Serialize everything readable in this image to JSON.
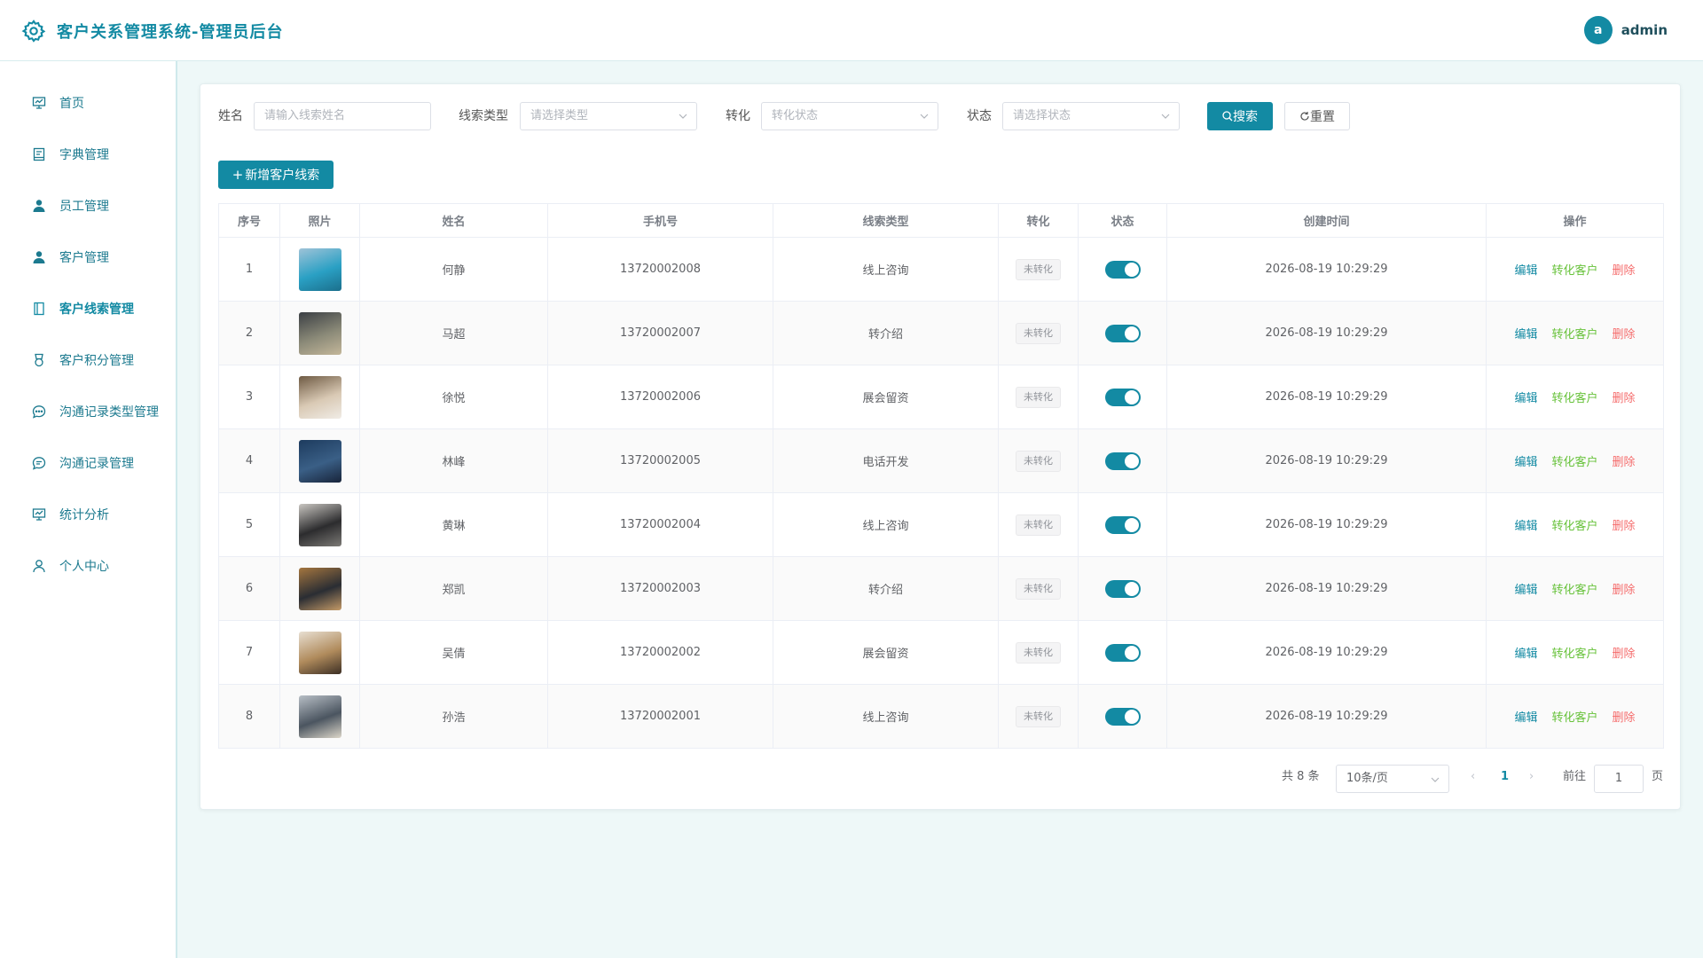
{
  "header": {
    "title": "客户关系管理系统-管理员后台",
    "avatar_letter": "a",
    "username": "admin"
  },
  "sidebar": {
    "items": [
      {
        "label": "首页",
        "icon": "dashboard-icon"
      },
      {
        "label": "字典管理",
        "icon": "book-icon"
      },
      {
        "label": "员工管理",
        "icon": "user-icon"
      },
      {
        "label": "客户管理",
        "icon": "user-icon"
      },
      {
        "label": "客户线索管理",
        "icon": "notebook-icon"
      },
      {
        "label": "客户积分管理",
        "icon": "medal-icon"
      },
      {
        "label": "沟通记录类型管理",
        "icon": "chat-dot-icon"
      },
      {
        "label": "沟通记录管理",
        "icon": "chat-line-icon"
      },
      {
        "label": "统计分析",
        "icon": "chart-icon"
      },
      {
        "label": "个人中心",
        "icon": "person-icon"
      }
    ],
    "active_index": 4
  },
  "filters": {
    "name_label": "姓名",
    "name_placeholder": "请输入线索姓名",
    "type_label": "线索类型",
    "type_placeholder": "请选择类型",
    "convert_label": "转化",
    "convert_placeholder": "转化状态",
    "status_label": "状态",
    "status_placeholder": "请选择状态",
    "search_button": "搜索",
    "reset_button": "重置"
  },
  "toolbar": {
    "add_button": "新增客户线索"
  },
  "table": {
    "columns": [
      "序号",
      "照片",
      "姓名",
      "手机号",
      "线索类型",
      "转化",
      "状态",
      "创建时间",
      "操作"
    ],
    "rows": [
      {
        "index": "1",
        "name": "何静",
        "phone": "13720002008",
        "type": "线上咨询",
        "convert": "未转化",
        "status_on": true,
        "created": "2026-08-19 10:29:29"
      },
      {
        "index": "2",
        "name": "马超",
        "phone": "13720002007",
        "type": "转介绍",
        "convert": "未转化",
        "status_on": true,
        "created": "2026-08-19 10:29:29"
      },
      {
        "index": "3",
        "name": "徐悦",
        "phone": "13720002006",
        "type": "展会留资",
        "convert": "未转化",
        "status_on": true,
        "created": "2026-08-19 10:29:29"
      },
      {
        "index": "4",
        "name": "林峰",
        "phone": "13720002005",
        "type": "电话开发",
        "convert": "未转化",
        "status_on": true,
        "created": "2026-08-19 10:29:29"
      },
      {
        "index": "5",
        "name": "黄琳",
        "phone": "13720002004",
        "type": "线上咨询",
        "convert": "未转化",
        "status_on": true,
        "created": "2026-08-19 10:29:29"
      },
      {
        "index": "6",
        "name": "郑凯",
        "phone": "13720002003",
        "type": "转介绍",
        "convert": "未转化",
        "status_on": true,
        "created": "2026-08-19 10:29:29"
      },
      {
        "index": "7",
        "name": "吴倩",
        "phone": "13720002002",
        "type": "展会留资",
        "convert": "未转化",
        "status_on": true,
        "created": "2026-08-19 10:29:29"
      },
      {
        "index": "8",
        "name": "孙浩",
        "phone": "13720002001",
        "type": "线上咨询",
        "convert": "未转化",
        "status_on": true,
        "created": "2026-08-19 10:29:29"
      }
    ],
    "actions": {
      "edit": "编辑",
      "convert": "转化客户",
      "delete": "删除"
    }
  },
  "pagination": {
    "total_text": "共 8 条",
    "page_size": "10条/页",
    "current_page": "1",
    "goto_label": "前往",
    "goto_value": "1",
    "page_unit": "页"
  },
  "colors": {
    "primary": "#138aa3",
    "success": "#67c23a",
    "danger": "#f56c6c"
  }
}
